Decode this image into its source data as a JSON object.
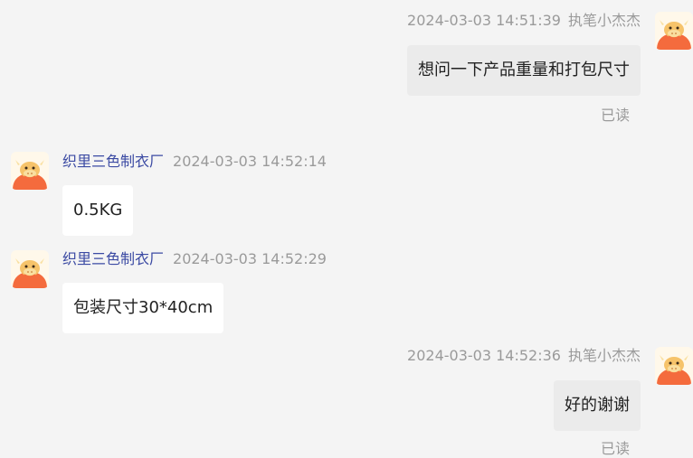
{
  "messages": [
    {
      "direction": "out",
      "timestamp": "2024-03-03 14:51:39",
      "sender": "执笔小杰杰",
      "text": "想问一下产品重量和打包尺寸",
      "status": "已读"
    },
    {
      "direction": "in",
      "timestamp": "2024-03-03 14:52:14",
      "sender": "织里三色制衣厂",
      "text": "0.5KG"
    },
    {
      "direction": "in",
      "timestamp": "2024-03-03 14:52:29",
      "sender": "织里三色制衣厂",
      "text": "包装尺寸30*40cm"
    },
    {
      "direction": "out",
      "timestamp": "2024-03-03 14:52:36",
      "sender": "执笔小杰杰",
      "text": "好的谢谢",
      "status": "已读"
    }
  ],
  "avatar": {
    "icon": "bull-mascot-icon",
    "colors": {
      "body": "#f46b3d",
      "face": "#f6c36a",
      "horn": "#f9dfa0",
      "background": "#fff8ea"
    }
  },
  "colors": {
    "page_background": "#f4f4f4",
    "outgoing_bubble": "#ebebeb",
    "incoming_bubble": "#ffffff",
    "sender_name_incoming": "#3b4aa3",
    "meta_text": "#9a9a9a"
  }
}
